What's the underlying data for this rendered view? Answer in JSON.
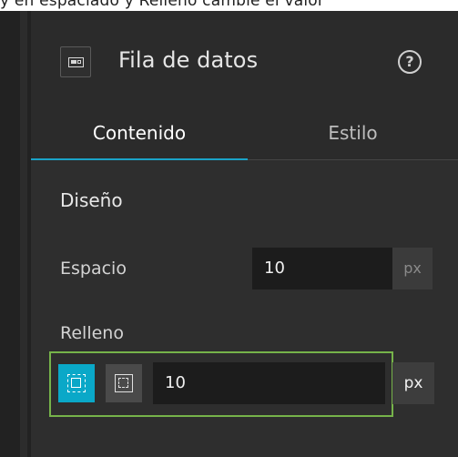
{
  "caption_fragment": "y en espaciado y Relleno cambie el valor",
  "panel": {
    "title": "Fila de datos",
    "widget_icon": "data-row-icon",
    "help_icon": "question-circle-icon",
    "help_glyph": "?"
  },
  "tabs": [
    {
      "label": "Contenido",
      "active": true
    },
    {
      "label": "Estilo",
      "active": false
    }
  ],
  "layout_section": {
    "title": "Diseño",
    "espacio": {
      "label": "Espacio",
      "value": "10",
      "unit": "px"
    },
    "relleno": {
      "label": "Relleno",
      "value": "10",
      "unit": "px",
      "mode_buttons": [
        {
          "icon": "padding-uniform-icon",
          "selected": true
        },
        {
          "icon": "padding-individual-icon",
          "selected": false
        }
      ]
    }
  },
  "colors": {
    "accent": "#1aa3c7",
    "selected_button": "#0aa8c8",
    "highlight_border": "#76b34a",
    "panel_bg": "#2b2b2b"
  }
}
